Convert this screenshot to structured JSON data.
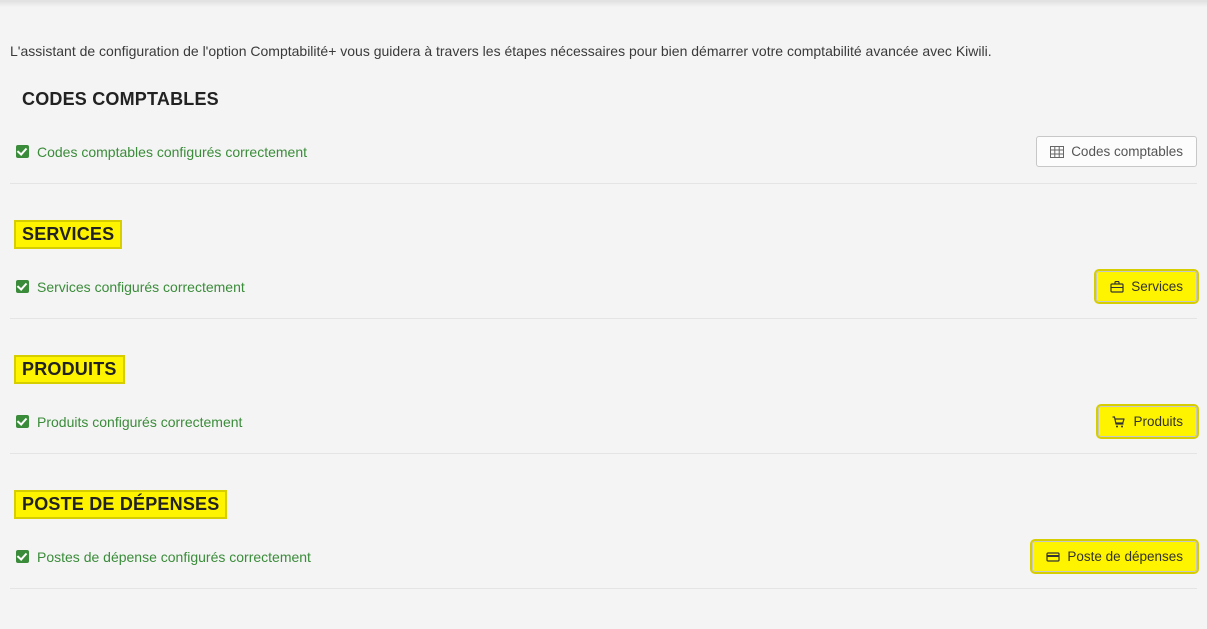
{
  "intro": "L'assistant de configuration de l'option Comptabilité+ vous guidera à travers les étapes nécessaires pour bien démarrer votre comptabilité avancée avec Kiwili.",
  "sections": {
    "codes": {
      "title": "CODES COMPTABLES",
      "status": "Codes comptables configurés correctement",
      "button": "Codes comptables",
      "highlight": false
    },
    "services": {
      "title": "SERVICES",
      "status": "Services configurés correctement",
      "button": "Services",
      "highlight": true
    },
    "produits": {
      "title": "PRODUITS",
      "status": "Produits configurés correctement",
      "button": "Produits",
      "highlight": true
    },
    "depenses": {
      "title": "POSTE DE DÉPENSES",
      "status": "Postes de dépense configurés correctement",
      "button": "Poste de dépenses",
      "highlight": true
    }
  }
}
